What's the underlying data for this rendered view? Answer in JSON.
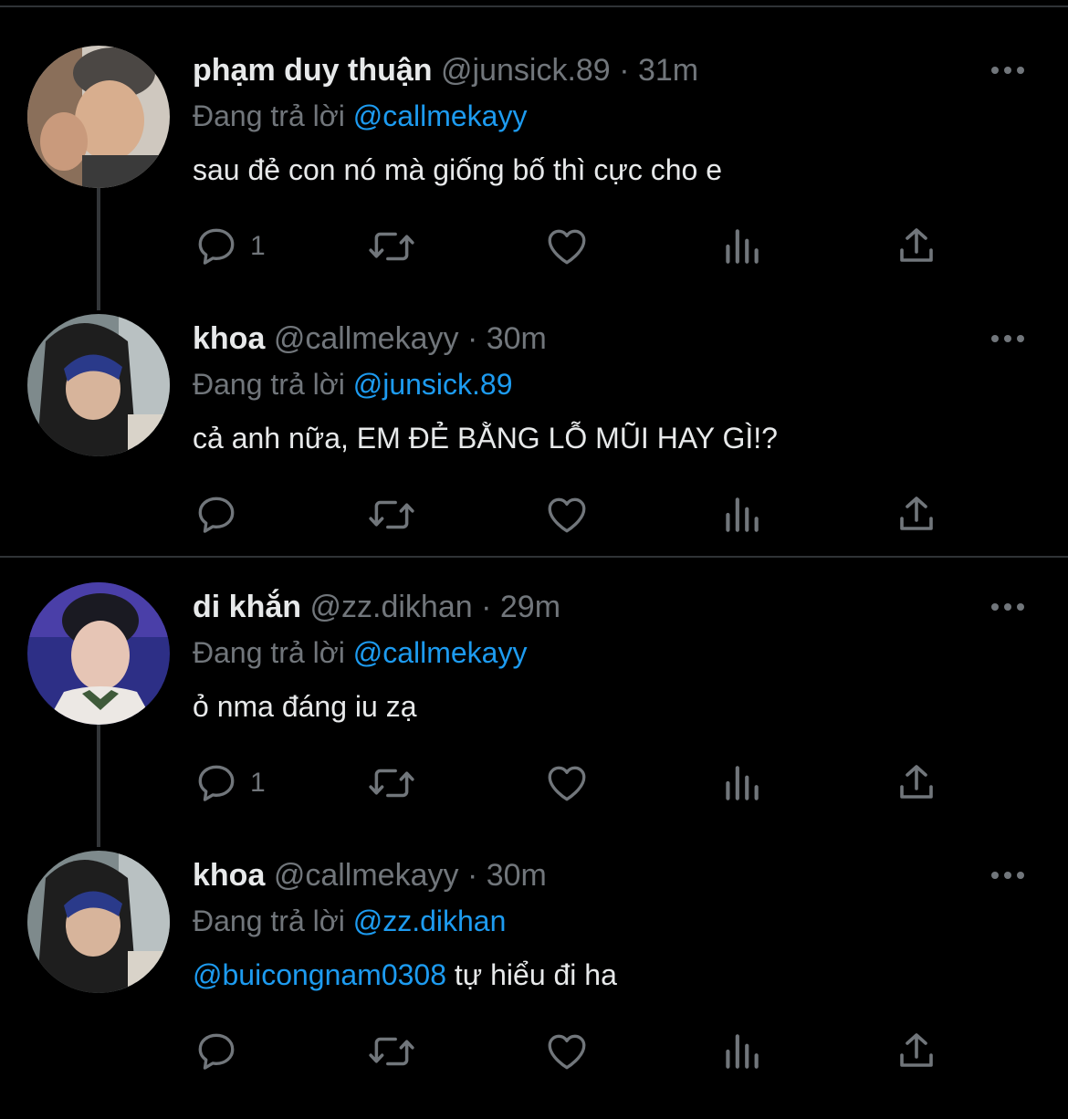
{
  "reply_prefix": "Đang trả lời",
  "separator": "·",
  "tweets": [
    {
      "name": "phạm duy thuận",
      "handle": "@junsick.89",
      "time": "31m",
      "reply_to": "@callmekayy",
      "text_mention": "",
      "text": "sau đẻ con nó mà giống bố thì cực cho e",
      "reply_count": "1",
      "avatar_icon": "profile-photo"
    },
    {
      "name": "khoa",
      "handle": "@callmekayy",
      "time": "30m",
      "reply_to": "@junsick.89",
      "text_mention": "",
      "text": "cả anh nữa, EM ĐẺ BẰNG LỖ MŨI HAY GÌ!?",
      "reply_count": "",
      "avatar_icon": "profile-photo"
    },
    {
      "name": "di khắn",
      "handle": "@zz.dikhan",
      "time": "29m",
      "reply_to": "@callmekayy",
      "text_mention": "",
      "text": "ỏ nma đáng iu zạ",
      "reply_count": "1",
      "avatar_icon": "profile-photo"
    },
    {
      "name": "khoa",
      "handle": "@callmekayy",
      "time": "30m",
      "reply_to": "@zz.dikhan",
      "text_mention": "@buicongnam0308",
      "text": " tự hiểu đi ha",
      "reply_count": "",
      "avatar_icon": "profile-photo"
    }
  ],
  "icons": {
    "reply": "reply-icon",
    "retweet": "retweet-icon",
    "like": "heart-icon",
    "views": "views-icon",
    "share": "share-icon",
    "more": "more-icon"
  },
  "colors": {
    "background": "#000000",
    "text": "#e7e9ea",
    "muted": "#71767b",
    "mention": "#1d9bf0",
    "divider": "#2f3336"
  }
}
